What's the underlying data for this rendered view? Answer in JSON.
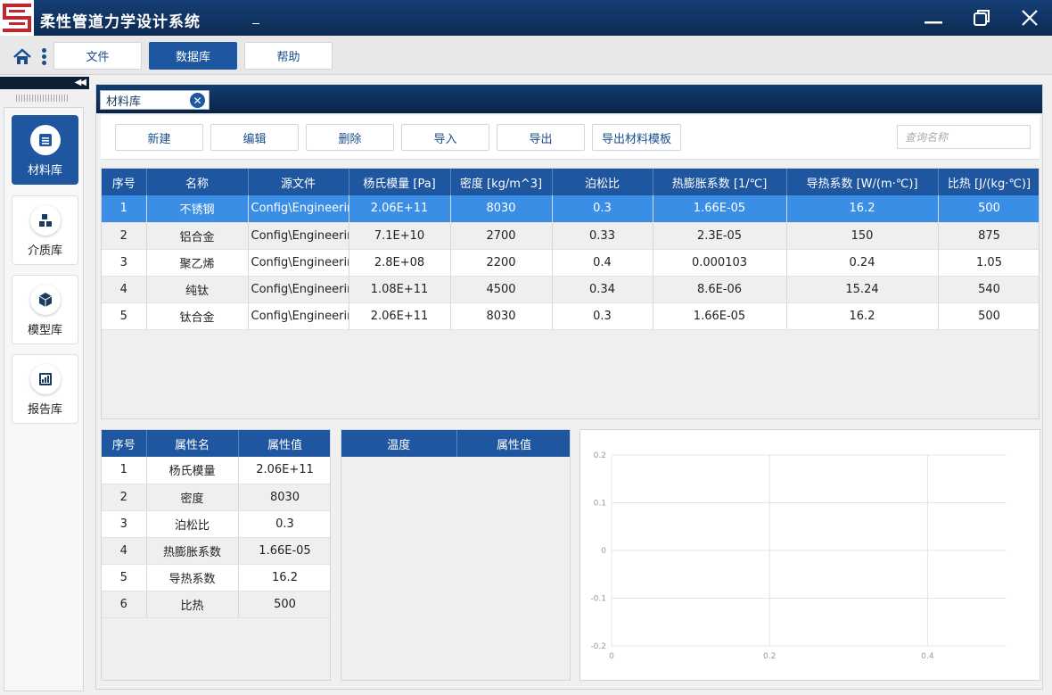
{
  "app": {
    "title": "柔性管道力学设计系统"
  },
  "menu": {
    "tabs": [
      "文件",
      "数据库",
      "帮助"
    ],
    "active": 1
  },
  "sidebar": {
    "items": [
      {
        "label": "材料库",
        "icon": "list-icon",
        "active": true
      },
      {
        "label": "介质库",
        "icon": "blocks-icon",
        "active": false
      },
      {
        "label": "模型库",
        "icon": "cube-icon",
        "active": false
      },
      {
        "label": "报告库",
        "icon": "report-icon",
        "active": false
      }
    ]
  },
  "doc_tab": {
    "label": "材料库"
  },
  "toolbar": {
    "buttons": [
      "新建",
      "编辑",
      "删除",
      "导入",
      "导出",
      "导出材料模板"
    ],
    "search_placeholder": "查询名称"
  },
  "materials": {
    "columns": [
      "序号",
      "名称",
      "源文件",
      "杨氏模量 [Pa]",
      "密度 [kg/m^3]",
      "泊松比",
      "热膨胀系数 [1/℃]",
      "导热系数 [W/(m·℃)]",
      "比热 [J/(kg·℃)]"
    ],
    "selected_index": 0,
    "rows": [
      [
        "1",
        "不锈钢",
        "Config\\Engineering",
        "2.06E+11",
        "8030",
        "0.3",
        "1.66E-05",
        "16.2",
        "500"
      ],
      [
        "2",
        "铝合金",
        "Config\\Engineering",
        "7.1E+10",
        "2700",
        "0.33",
        "2.3E-05",
        "150",
        "875"
      ],
      [
        "3",
        "聚乙烯",
        "Config\\Engineering",
        "2.8E+08",
        "2200",
        "0.4",
        "0.000103",
        "0.24",
        "1.05"
      ],
      [
        "4",
        "纯钛",
        "Config\\Engineering",
        "1.08E+11",
        "4500",
        "0.34",
        "8.6E-06",
        "15.24",
        "540"
      ],
      [
        "5",
        "钛合金",
        "Config\\Engineering",
        "2.06E+11",
        "8030",
        "0.3",
        "1.66E-05",
        "16.2",
        "500"
      ]
    ]
  },
  "properties": {
    "columns": [
      "序号",
      "属性名",
      "属性值"
    ],
    "rows": [
      [
        "1",
        "杨氏模量",
        "2.06E+11"
      ],
      [
        "2",
        "密度",
        "8030"
      ],
      [
        "3",
        "泊松比",
        "0.3"
      ],
      [
        "4",
        "热膨胀系数",
        "1.66E-05"
      ],
      [
        "5",
        "导热系数",
        "16.2"
      ],
      [
        "6",
        "比热",
        "500"
      ]
    ]
  },
  "temperature_table": {
    "columns": [
      "温度",
      "属性值"
    ],
    "rows": []
  },
  "chart_data": {
    "type": "line",
    "series": [],
    "xlim": [
      0,
      0.5
    ],
    "ylim": [
      -0.2,
      0.2
    ],
    "x_ticks": [
      "0",
      "0.2",
      "0.4"
    ],
    "y_ticks": [
      "0.2",
      "0.1",
      "0",
      "-0.1",
      "-0.2"
    ],
    "grid": true
  }
}
